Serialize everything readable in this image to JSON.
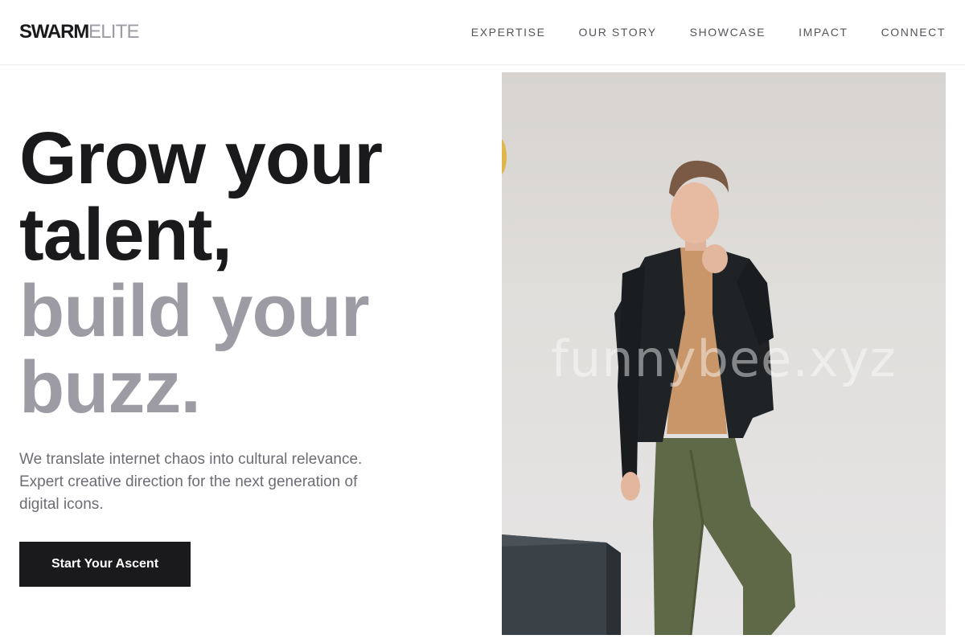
{
  "brand": {
    "logo_primary": "SWARM",
    "logo_secondary": "ELITE"
  },
  "nav": {
    "items": [
      {
        "label": "EXPERTISE"
      },
      {
        "label": "OUR STORY"
      },
      {
        "label": "SHOWCASE"
      },
      {
        "label": "IMPACT"
      },
      {
        "label": "CONNECT"
      }
    ]
  },
  "hero": {
    "headline_line1": "Grow your",
    "headline_line2": "talent,",
    "headline_line3": "build your",
    "headline_line4": "buzz.",
    "description": "We translate internet chaos into cultural relevance. Expert creative direction for the next generation of digital icons.",
    "cta_label": "Start Your Ascent",
    "image_watermark": "funnybee.xyz"
  },
  "colors": {
    "text_dark": "#1a1a1c",
    "text_muted": "#9d9ca5",
    "button_bg": "#1a1a1c",
    "button_text": "#ffffff"
  }
}
